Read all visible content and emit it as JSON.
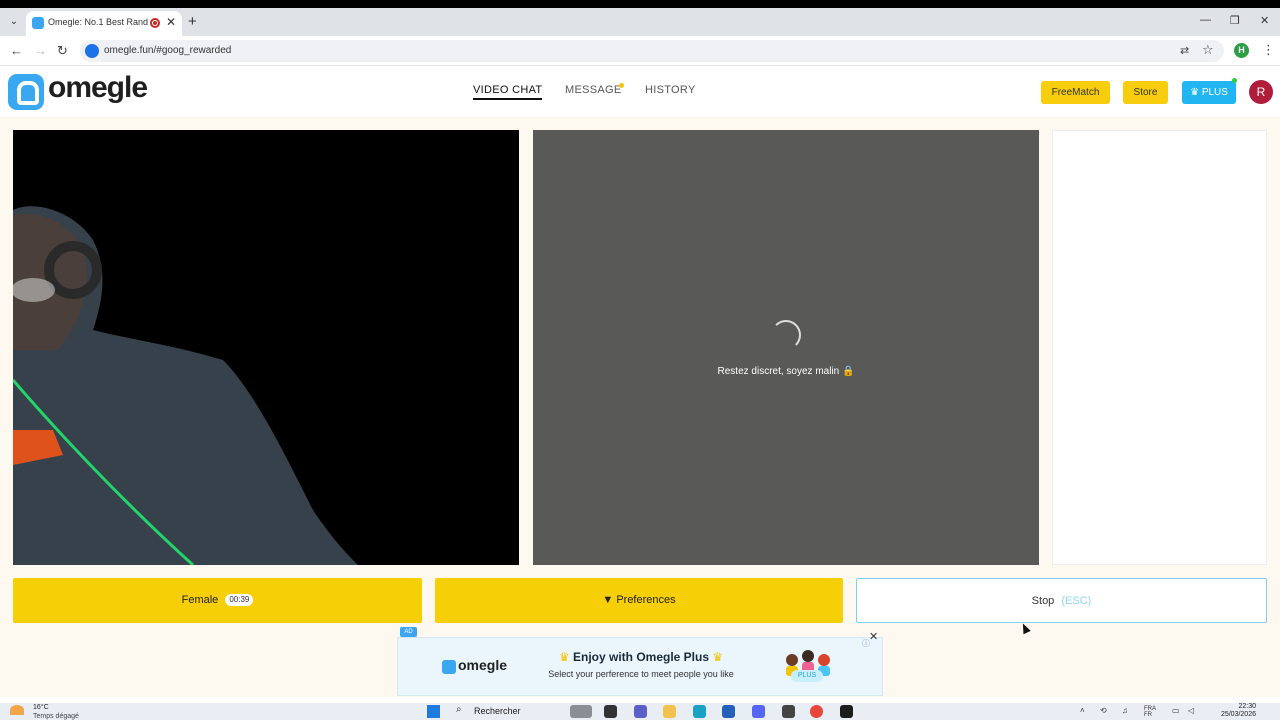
{
  "browser": {
    "tab_title": "Omegle: No.1 Best Random",
    "url": "omegle.fun/#goog_rewarded"
  },
  "site": {
    "logo_text": "omegle",
    "nav": {
      "video_chat": "VIDEO CHAT",
      "message": "MESSAGE",
      "history": "HISTORY"
    },
    "buttons": {
      "freematch": "FreeMatch",
      "store": "Store",
      "plus": "PLUS"
    },
    "avatar_initial": "R",
    "colors": {
      "accent_yellow": "#f6cf07",
      "plus_blue": "#21b6f1",
      "avatar": "#b01d3b",
      "remote_bg": "#595957"
    }
  },
  "remote": {
    "status": "Restez discret, soyez malin 🔒"
  },
  "actions": {
    "gender": "Female",
    "timer": "00:39",
    "preferences": "Preferences",
    "stop": "Stop",
    "stop_hint": "(ESC)"
  },
  "ad": {
    "badge": "AD",
    "logo": "omegle",
    "title": "Enjoy with Omegle Plus",
    "subtitle": "Select your perference to meet people you like",
    "plus_label": "PLUS"
  },
  "taskbar": {
    "weather_temp": "16°C",
    "weather_desc": "Temps dégagé",
    "search": "Rechercher",
    "lang": "FRA",
    "lang_sub": "FR",
    "time": "22:30",
    "date": "25/03/2026"
  }
}
